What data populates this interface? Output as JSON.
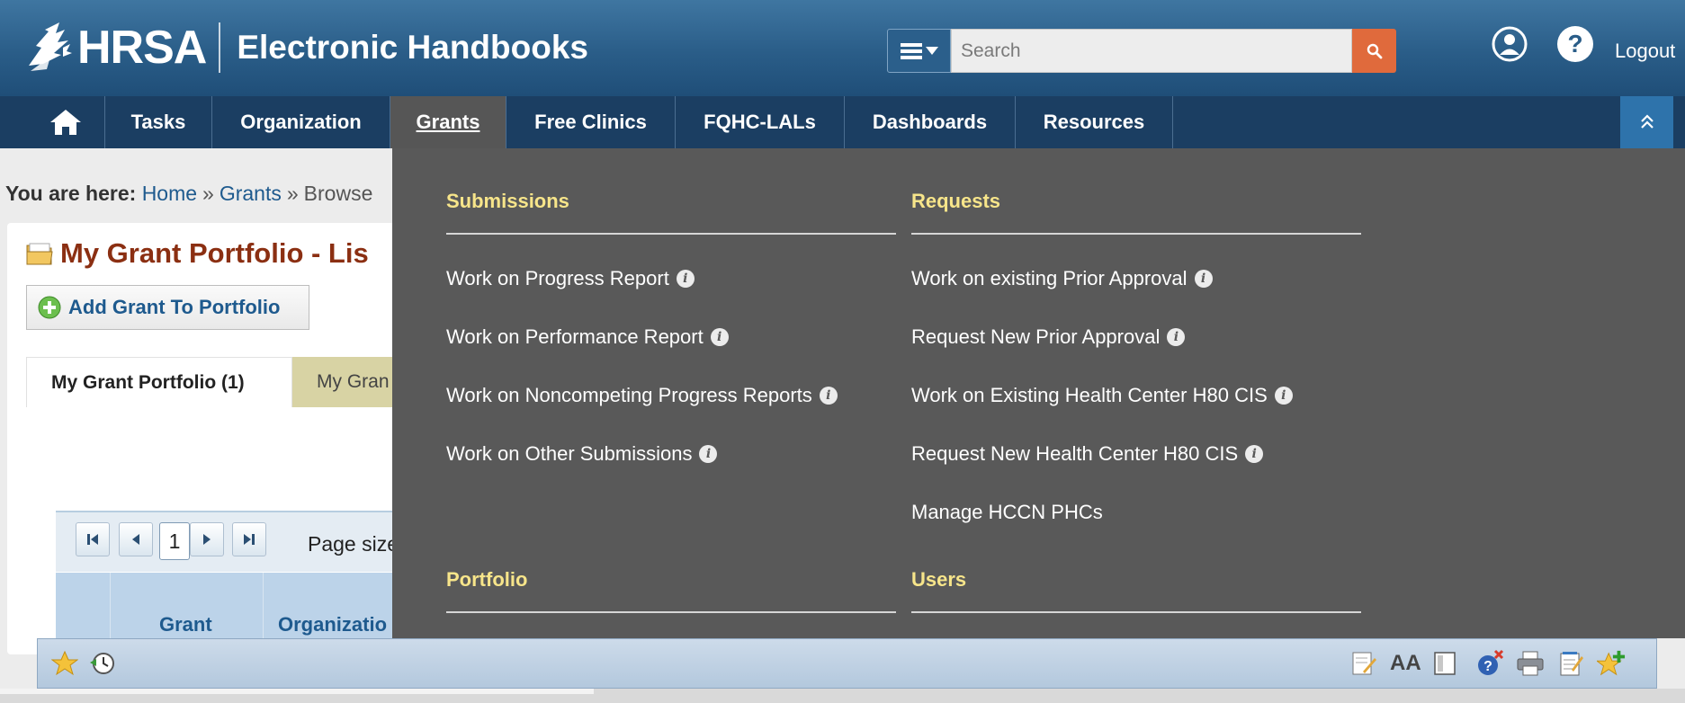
{
  "header": {
    "logo_text": "HRSA",
    "app_title": "Electronic Handbooks",
    "search_placeholder": "Search",
    "logout_label": "Logout"
  },
  "nav": {
    "items": [
      {
        "label": "Tasks"
      },
      {
        "label": "Organization"
      },
      {
        "label": "Grants"
      },
      {
        "label": "Free Clinics"
      },
      {
        "label": "FQHC-LALs"
      },
      {
        "label": "Dashboards"
      },
      {
        "label": "Resources"
      }
    ],
    "active": "Grants"
  },
  "breadcrumb": {
    "prefix": "You are here:",
    "items": [
      "Home",
      "Grants",
      "Browse"
    ]
  },
  "page": {
    "title": "My Grant Portfolio - Lis",
    "add_button": "Add Grant To Portfolio",
    "tabs": [
      {
        "label": "My Grant Portfolio (1)",
        "active": true
      },
      {
        "label": "My Gran",
        "active": false
      }
    ],
    "pager": {
      "current_page": "1",
      "page_size_label": "Page size"
    },
    "columns": [
      "Grant",
      "Organizatio"
    ]
  },
  "mega_menu": {
    "submissions": {
      "heading": "Submissions",
      "links": [
        "Work on Progress Report",
        "Work on Performance Report",
        "Work on Noncompeting Progress Reports",
        "Work on Other Submissions"
      ]
    },
    "requests": {
      "heading": "Requests",
      "links": [
        "Work on existing Prior Approval",
        "Request New Prior Approval",
        "Work on Existing Health Center H80 CIS",
        "Request New Health Center H80 CIS",
        "Manage HCCN PHCs"
      ]
    },
    "portfolio": {
      "heading": "Portfolio"
    },
    "users": {
      "heading": "Users"
    }
  },
  "toolbar": {
    "font_size_label": "AA"
  },
  "colors": {
    "header_blue": "#2a5d88",
    "nav_dark": "#1b3e62",
    "menu_gray": "#595959",
    "menu_heading": "#f7e58a",
    "search_button": "#e06a3c",
    "title_brown": "#8b2f12",
    "link_blue": "#1e5a8e"
  }
}
